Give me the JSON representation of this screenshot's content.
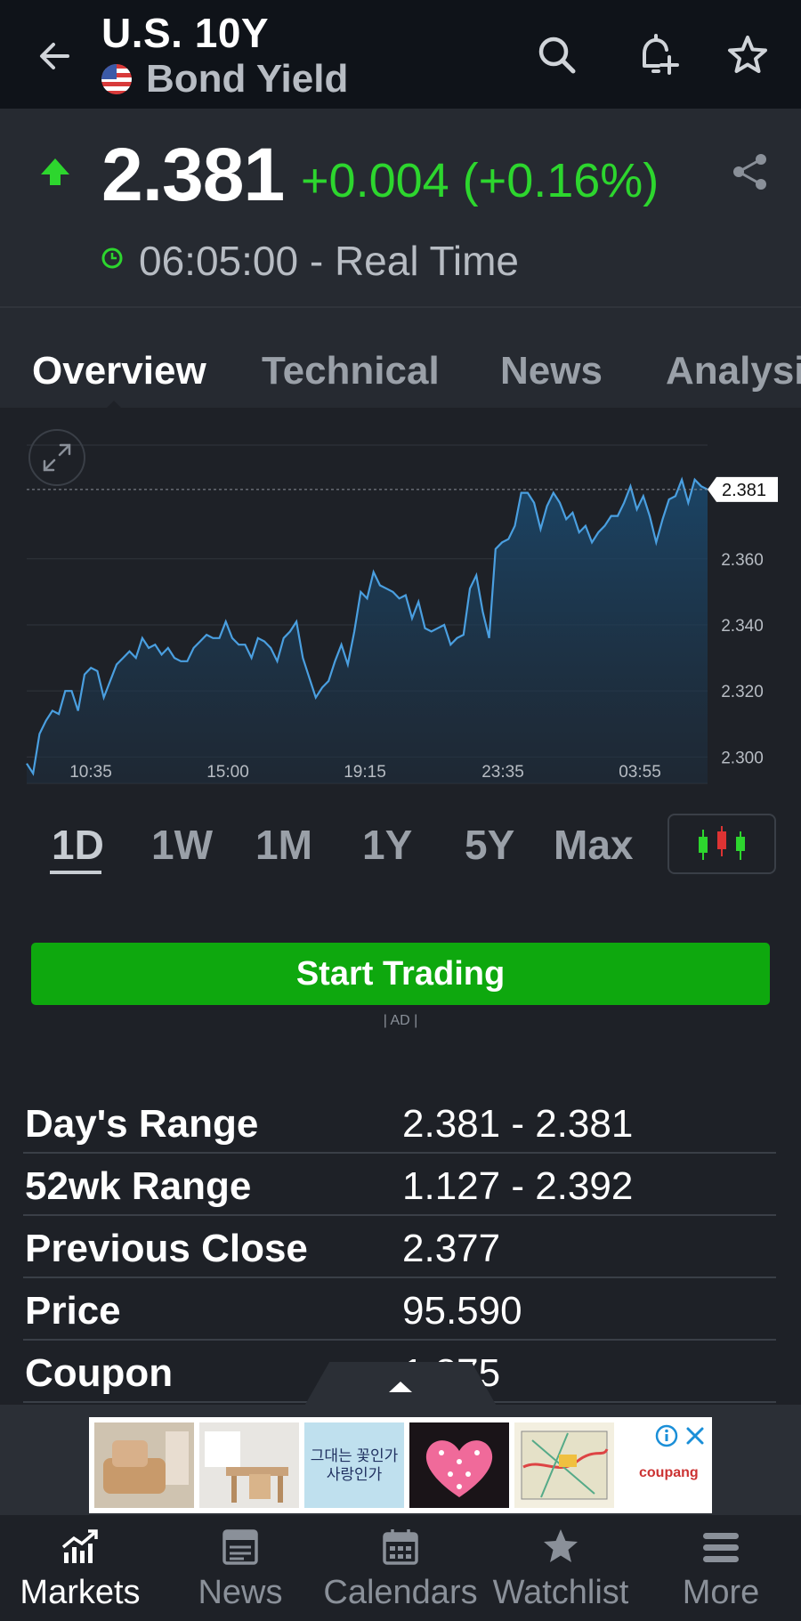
{
  "header": {
    "title": "U.S. 10Y",
    "subtitle": "Bond Yield",
    "icons": [
      "back-arrow-icon",
      "search-icon",
      "add-alert-icon",
      "star-icon"
    ]
  },
  "quote": {
    "price": "2.381",
    "change": "+0.004 (+0.16%)",
    "time": "06:05:00 - Real Time",
    "direction": "up",
    "change_color": "#2dd62e"
  },
  "tabs": [
    "Overview",
    "Technical",
    "News",
    "Analysis"
  ],
  "chart_data": {
    "type": "area",
    "x_tick_labels": [
      "10:35",
      "15:00",
      "19:15",
      "23:35",
      "03:55"
    ],
    "y_tick_labels": [
      "2.360",
      "2.340",
      "2.320",
      "2.300"
    ],
    "current_label": "2.381",
    "ylim": [
      2.292,
      2.395
    ],
    "grid": true,
    "line_color": "#4a9fe0",
    "series": [
      {
        "values": [
          2.298,
          2.295,
          2.307,
          2.311,
          2.314,
          2.313,
          2.32,
          2.32,
          2.314,
          2.325,
          2.327,
          2.326,
          2.318,
          2.323,
          2.328,
          2.33,
          2.332,
          2.33,
          2.336,
          2.333,
          2.334,
          2.331,
          2.333,
          2.33,
          2.329,
          2.329,
          2.333,
          2.335,
          2.337,
          2.336,
          2.336,
          2.341,
          2.336,
          2.334,
          2.334,
          2.33,
          2.336,
          2.335,
          2.333,
          2.329,
          2.336,
          2.338,
          2.341,
          2.33,
          2.324,
          2.318,
          2.321,
          2.323,
          2.329,
          2.334,
          2.328,
          2.338,
          2.35,
          2.348,
          2.356,
          2.352,
          2.351,
          2.35,
          2.348,
          2.349,
          2.342,
          2.347,
          2.339,
          2.338,
          2.339,
          2.34,
          2.334,
          2.336,
          2.337,
          2.351,
          2.355,
          2.344,
          2.336,
          2.363,
          2.365,
          2.366,
          2.37,
          2.38,
          2.38,
          2.377,
          2.369,
          2.376,
          2.38,
          2.377,
          2.372,
          2.374,
          2.368,
          2.37,
          2.365,
          2.368,
          2.37,
          2.373,
          2.373,
          2.377,
          2.382,
          2.375,
          2.379,
          2.373,
          2.365,
          2.372,
          2.378,
          2.379,
          2.384,
          2.377,
          2.384,
          2.382,
          2.381
        ]
      }
    ]
  },
  "range_buttons": [
    "1D",
    "1W",
    "1M",
    "1Y",
    "5Y",
    "Max"
  ],
  "active_range": "1D",
  "trade_button": "Start Trading",
  "ad_tag": "| AD |",
  "stats": [
    {
      "label": "Day's Range",
      "value": "2.381 - 2.381"
    },
    {
      "label": "52wk Range",
      "value": "1.127 - 2.392"
    },
    {
      "label": "Previous Close",
      "value": "2.377"
    },
    {
      "label": "Price",
      "value": "95.590"
    },
    {
      "label": "Coupon",
      "value": "1.875"
    }
  ],
  "ad": {
    "brand": "coupang",
    "image_text": "그대는 꽃인가 사랑인가"
  },
  "bottom_nav": [
    {
      "label": "Markets",
      "icon": "markets-chart-icon",
      "active": true
    },
    {
      "label": "News",
      "icon": "news-icon",
      "active": false
    },
    {
      "label": "Calendars",
      "icon": "calendar-icon",
      "active": false
    },
    {
      "label": "Watchlist",
      "icon": "star-icon",
      "active": false
    },
    {
      "label": "More",
      "icon": "menu-icon",
      "active": false
    }
  ]
}
